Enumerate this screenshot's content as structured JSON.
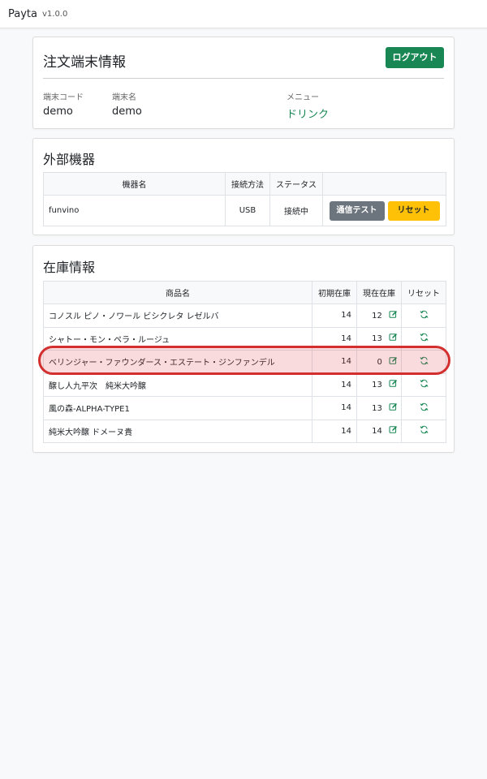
{
  "app": {
    "brand": "Payta",
    "version": "v1.0.0"
  },
  "terminal": {
    "title": "注文端末情報",
    "logout_label": "ログアウト",
    "code_label": "端末コード",
    "code_value": "demo",
    "name_label": "端末名",
    "name_value": "demo",
    "menu_label": "メニュー",
    "menu_value": "ドリンク"
  },
  "devices": {
    "title": "外部機器",
    "headers": [
      "機器名",
      "接続方法",
      "ステータス",
      ""
    ],
    "rows": [
      {
        "name": "funvino",
        "method": "USB",
        "status": "接続中",
        "test_label": "通信テスト",
        "reset_label": "リセット"
      }
    ]
  },
  "stock": {
    "title": "在庫情報",
    "headers": [
      "商品名",
      "初期在庫",
      "現在在庫",
      "リセット"
    ],
    "rows": [
      {
        "name": "コノスル ピノ・ノワール ビシクレタ レゼルバ",
        "initial": "14",
        "current": "12"
      },
      {
        "name": "シャトー・モン・ペラ・ルージュ",
        "initial": "14",
        "current": "13"
      },
      {
        "name": "ベリンジャー・ファウンダース・エステート・ジンファンデル",
        "initial": "14",
        "current": "0"
      },
      {
        "name": "醸し人九平次　純米大吟醸",
        "initial": "14",
        "current": "13"
      },
      {
        "name": "風の森-ALPHA-TYPE1",
        "initial": "14",
        "current": "13"
      },
      {
        "name": "純米大吟醸 ドメーヌ貴",
        "initial": "14",
        "current": "14"
      }
    ]
  },
  "colors": {
    "primary_green": "#198754",
    "secondary_gray": "#6c757d",
    "warning_yellow": "#ffc107",
    "highlight_red": "#d32f2f"
  }
}
